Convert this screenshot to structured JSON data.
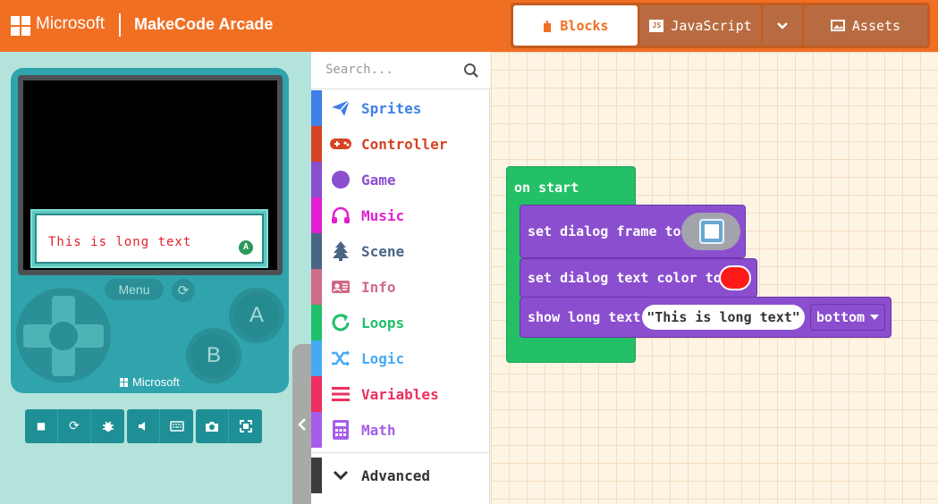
{
  "header": {
    "brand": "Microsoft",
    "app_title": "MakeCode Arcade",
    "tabs": {
      "blocks": "Blocks",
      "javascript": "JavaScript",
      "js_badge": "JS",
      "assets": "Assets"
    }
  },
  "simulator": {
    "dialog_text": "This is long text",
    "dialog_button": "A",
    "menu_label": "Menu",
    "button_a": "A",
    "button_b": "B",
    "brand": "Microsoft"
  },
  "toolbox": {
    "search_placeholder": "Search...",
    "categories": [
      {
        "label": "Sprites",
        "color": "#3f7fe8",
        "icon": "paper-plane-icon"
      },
      {
        "label": "Controller",
        "color": "#d54322",
        "icon": "gamepad-icon"
      },
      {
        "label": "Game",
        "color": "#8b4ecf",
        "icon": "circle-icon"
      },
      {
        "label": "Music",
        "color": "#e21fd0",
        "icon": "headphones-icon"
      },
      {
        "label": "Scene",
        "color": "#4b6584",
        "icon": "tree-icon"
      },
      {
        "label": "Info",
        "color": "#cf6a87",
        "icon": "id-card-icon"
      },
      {
        "label": "Loops",
        "color": "#20bf6b",
        "icon": "refresh-icon"
      },
      {
        "label": "Logic",
        "color": "#45aaf2",
        "icon": "shuffle-icon"
      },
      {
        "label": "Variables",
        "color": "#ee2f5f",
        "icon": "list-icon"
      },
      {
        "label": "Math",
        "color": "#a55eea",
        "icon": "calculator-icon"
      }
    ],
    "advanced": "Advanced"
  },
  "workspace": {
    "on_start": "on start",
    "block1": "set dialog frame to",
    "block2": "set dialog text color to",
    "block3": "show long text",
    "text_value": "\"This is long text\"",
    "position_value": "bottom",
    "text_color": "#ff1a1a"
  }
}
